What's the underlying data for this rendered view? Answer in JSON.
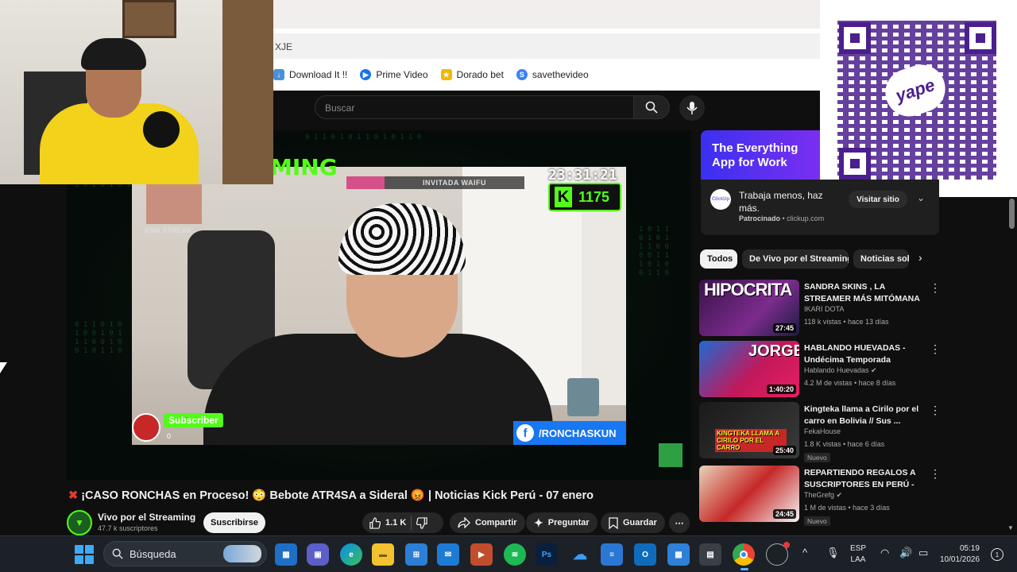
{
  "browser": {
    "address_text": "XJE",
    "bookmarks": [
      {
        "label": "Download It !!",
        "icon": "download-icon",
        "color": "#4a90d9"
      },
      {
        "label": "Prime Video",
        "icon": "prime-video-icon",
        "color": "#1a73e8"
      },
      {
        "label": "Dorado bet",
        "icon": "dorado-bet-icon",
        "color": "#f2b705"
      },
      {
        "label": "savethevideo",
        "icon": "savethevideo-icon",
        "color": "#3b82f6"
      }
    ]
  },
  "youtube": {
    "search_placeholder": "Buscar",
    "video": {
      "title_prefix": "✖",
      "title": "¡CASO RONCHAS en Proceso! 😳 Bebote ATR4SA a Sideral 😡 | Noticias Kick Perú - 07 enero",
      "overlay": {
        "clock": "23:31:21",
        "kick_count": "1175",
        "kick_letter": "K",
        "waifu_label": "INVITADA WAIFU",
        "streak_label": "636k STREAK",
        "brand_fragment": "MING",
        "subscriber_label": "Subscriber",
        "subscriber_count": "0",
        "fb_handle": "/RONCHASKUN",
        "fb_letter": "f"
      }
    },
    "channel": {
      "name": "Vivo por el Streaming",
      "subscribers": "47.7 k suscriptores",
      "subscribe_label": "Suscribirse"
    },
    "actions": {
      "likes": "1.1 K",
      "share": "Compartir",
      "ask": "Preguntar",
      "save": "Guardar",
      "more": "⋯"
    },
    "ad": {
      "headline": "The Everything App for Work",
      "text": "Trabaja menos, haz más.",
      "sponsored": "Patrocinado",
      "domain": "clickup.com",
      "logo_text": "ClickUp",
      "visit_label": "Visitar sitio"
    },
    "chips": [
      "Todos",
      "De Vivo por el Streaming",
      "Noticias sol"
    ],
    "recommendations": [
      {
        "thumb_text": "HIPOCRITA",
        "duration": "27:45",
        "title": "SANDRA SKINS , LA STREAMER MÁS MITÓMANA E HIPÓCRIT...",
        "channel": "IKARI DOTA",
        "meta": "118 k vistas • hace 13 días",
        "badge": "",
        "thumb_color": "#5a1e6b"
      },
      {
        "thumb_text": "JORGE",
        "duration": "1:40:20",
        "title": "HABLANDO HUEVADAS - Undécima Temporada [JORGE ...",
        "channel": "Hablando Huevadas ✔",
        "meta": "4.2 M de vistas • hace 8 días",
        "badge": "",
        "thumb_color": "#9c1c6e"
      },
      {
        "thumb_text": "KINGTEKA LLAMA A CIRILO POR EL CARRO",
        "duration": "25:40",
        "title": "Kingteka llama a Cirilo por el carro en Bolivia // Sus ...",
        "channel": "FekaHouse",
        "meta": "1.8 K vistas • hace 6 días",
        "badge": "Nuevo",
        "thumb_color": "#2b2b2b"
      },
      {
        "thumb_text": "",
        "duration": "24:45",
        "title": "REPARTIENDO REGALOS A SUSCRIPTORES EN PERÚ - ...",
        "channel": "TheGrefg ✔",
        "meta": "1 M de vistas • hace 3 días",
        "badge": "Nuevo",
        "thumb_color": "#b3322b"
      }
    ]
  },
  "taskbar": {
    "search_label": "Búsqueda",
    "lang_top": "ESP",
    "lang_bottom": "LAA",
    "time": "05:19",
    "date": "10/01/2026",
    "notifications": "1"
  },
  "qr": {
    "brand": "yape"
  }
}
